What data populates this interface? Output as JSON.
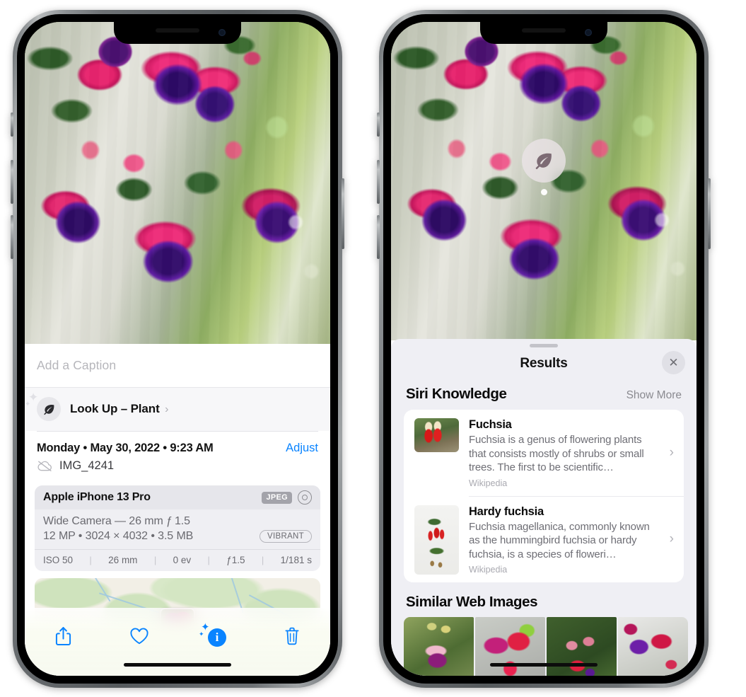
{
  "left_phone": {
    "photo": {
      "alt_description": "fuchsia-flowers-hanging-basket"
    },
    "caption_field": {
      "placeholder": "Add a Caption",
      "value": ""
    },
    "lookup_row": {
      "label": "Look Up",
      "separator": "–",
      "subject": "Plant",
      "chevron": "›",
      "icon": "leaf-icon"
    },
    "datetime": {
      "weekday": "Monday",
      "bullet": "•",
      "date": "May 30, 2022",
      "time": "9:23 AM",
      "full": "Monday • May 30, 2022 • 9:23 AM",
      "adjust_label": "Adjust"
    },
    "filename": {
      "name": "IMG_4241",
      "icon": "cloud-slash-icon"
    },
    "camera_card": {
      "model": "Apple iPhone 13 Pro",
      "format_badge": "JPEG",
      "raw_icon": "raw-ring-icon",
      "lens_line": "Wide Camera — 26 mm ƒ 1.5",
      "size_line": "12 MP • 3024 × 4032 • 3.5 MB",
      "style_badge": "VIBRANT",
      "exif": [
        {
          "label": "ISO 50"
        },
        {
          "label": "26 mm"
        },
        {
          "label": "0 ev"
        },
        {
          "label": "ƒ1.5"
        },
        {
          "label": "1/181 s"
        }
      ],
      "exif_separator": "|"
    },
    "map": {
      "pin": "photo-pin-thumbnail"
    },
    "toolbar": {
      "items": [
        {
          "name": "share-button",
          "icon": "share-icon"
        },
        {
          "name": "favorite-button",
          "icon": "heart-icon"
        },
        {
          "name": "info-button",
          "icon": "info-sparkle-icon",
          "glyph": "i",
          "active": true
        },
        {
          "name": "delete-button",
          "icon": "trash-icon"
        }
      ]
    }
  },
  "right_phone": {
    "photo_pin": {
      "icon": "leaf-icon",
      "label": "visual-look-up-indicator"
    },
    "sheet": {
      "grabber": "drag-handle",
      "title": "Results",
      "close_label": "✕"
    },
    "siri_knowledge": {
      "section_title": "Siri Knowledge",
      "show_more_label": "Show More",
      "items": [
        {
          "title": "Fuchsia",
          "description": "Fuchsia is a genus of flowering plants that consists mostly of shrubs or small trees. The first to be scientific…",
          "source": "Wikipedia",
          "thumbnail": "fuchsia-red-flowers-thumb",
          "chevron": "›"
        },
        {
          "title": "Hardy fuchsia",
          "description": "Fuchsia magellanica, commonly known as the hummingbird fuchsia or hardy fuchsia, is a species of floweri…",
          "source": "Wikipedia",
          "thumbnail": "hardy-fuchsia-specimen-thumb",
          "chevron": "›"
        }
      ]
    },
    "similar_web_images": {
      "section_title": "Similar Web Images",
      "thumbnails": [
        {
          "alt": "pink-white-fuchsia-thumb"
        },
        {
          "alt": "red-fuchsia-closeup-thumb"
        },
        {
          "alt": "fuchsia-shrub-thumb"
        },
        {
          "alt": "purple-red-fuchsia-thumb"
        }
      ]
    }
  },
  "colors": {
    "accent_blue": "#0a84ff",
    "sheet_gray": "#efeff4",
    "card_white": "#ffffff",
    "secondary_text": "#6e6e75",
    "tertiary_text": "#a9a9b0"
  }
}
